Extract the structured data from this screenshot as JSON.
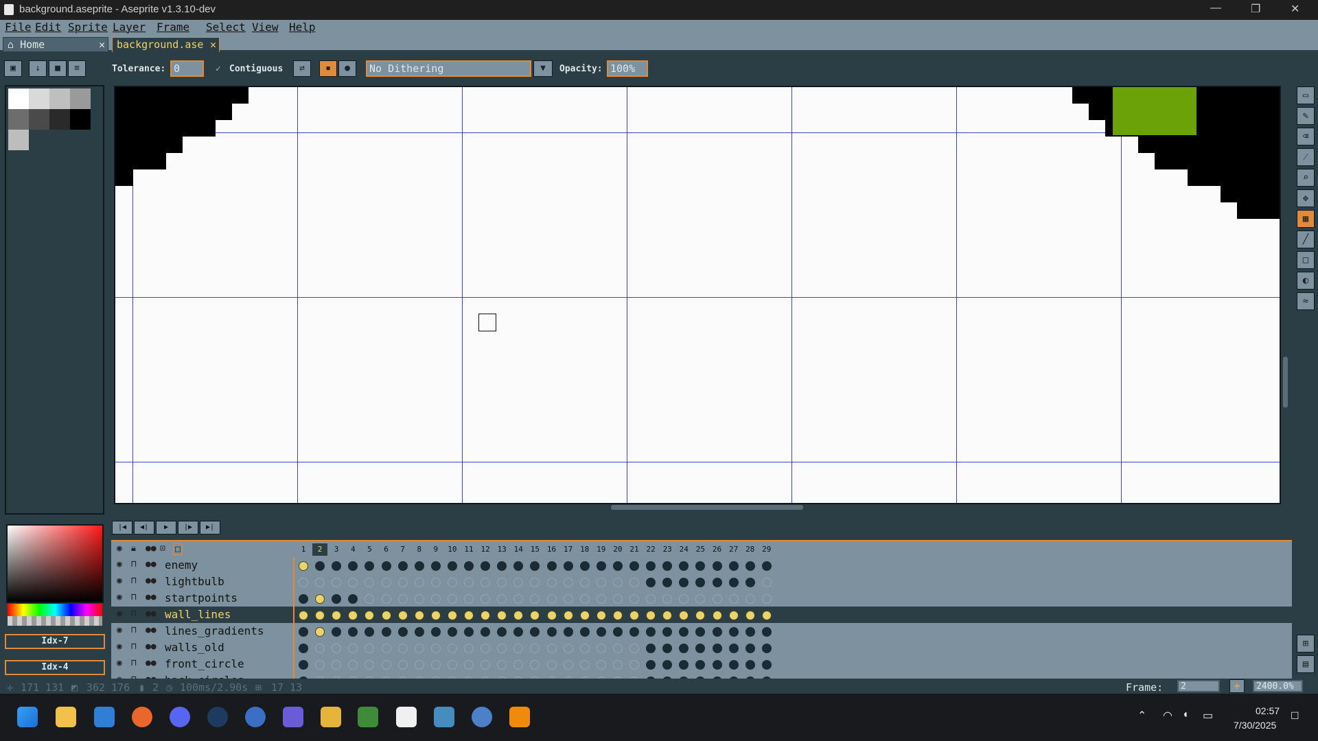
{
  "window": {
    "title": "background.aseprite - Aseprite v1.3.10-dev",
    "minimize": "—",
    "restore": "❐",
    "close": "✕"
  },
  "menu": [
    "File",
    "Edit",
    "Sprite",
    "Layer",
    "Frame",
    "Select",
    "View",
    "Help"
  ],
  "tabs": [
    {
      "label": "Home",
      "icon": "home-icon"
    },
    {
      "label": "background.ase",
      "close": "✕"
    }
  ],
  "context_bar": {
    "tolerance_label": "Tolerance:",
    "tolerance_value": "0",
    "contiguous_label": "Contiguous",
    "contiguous_checked": true,
    "dithering": "No Dithering",
    "opacity_label": "Opacity:",
    "opacity_value": "100%"
  },
  "palette_panel": {
    "idx_fg": "Idx-7",
    "idx_bg": "Idx-4",
    "swatches": [
      "#ffffff",
      "#d9d9d9",
      "#bfbfbf",
      "#9a9a9a",
      "#6d6d6d",
      "#4a4a4a",
      "#2a2a2a",
      "#000000",
      "#bdbdbd"
    ]
  },
  "canvas": {
    "highlight_color": "#6aa207",
    "grid_color": "#3b43c9"
  },
  "timeline": {
    "frames": [
      "1",
      "2",
      "3",
      "4",
      "5",
      "6",
      "7",
      "8",
      "9",
      "10",
      "11",
      "12",
      "13",
      "14",
      "15",
      "16",
      "17",
      "18",
      "19",
      "20",
      "21",
      "22",
      "23",
      "24",
      "25",
      "26",
      "27",
      "28",
      "29"
    ],
    "selected_frame": "2",
    "layers": [
      {
        "name": "enemy",
        "cels": "AFFFFFFFFFFFFFFFFFFFFFFFFFFFF"
      },
      {
        "name": "lightbulb",
        "cels": "EEEEEEEEEEEEEEEEEEEEEFFFFFFFE"
      },
      {
        "name": "startpoints",
        "cels": "FAFFEEEEEEEEEEEEEEEEEEEEEEEEE"
      },
      {
        "name": "wall_lines",
        "cels": "AAAAAAAAAAAAAAAAAAAAAAAAAAAAA",
        "selected": true
      },
      {
        "name": "lines_gradients",
        "cels": "FAFFFFFFFFFFFFFFFFFFFFFFFFFFF"
      },
      {
        "name": "walls_old",
        "cels": "FEEEEEEEEEEEEEEEEEEEEFFFFFFFF"
      },
      {
        "name": "front_circle",
        "cels": "FEEEEEEEEEEEEEEEEEEEEFFFFFFFF"
      },
      {
        "name": "back_circles",
        "cels": "FEEEEEEEEEEEEEEEEEEEEFFFFFFFF"
      }
    ]
  },
  "status_bar": {
    "cursor": "171 131",
    "selection": "362 176",
    "frame_info": "2",
    "duration": "100ms/2.90s",
    "grid": "17 13",
    "frame_label": "Frame:",
    "frame_value": "2",
    "zoom": "2400.0%"
  },
  "taskbar": {
    "time": "02:57",
    "date": "7/30/2025"
  }
}
